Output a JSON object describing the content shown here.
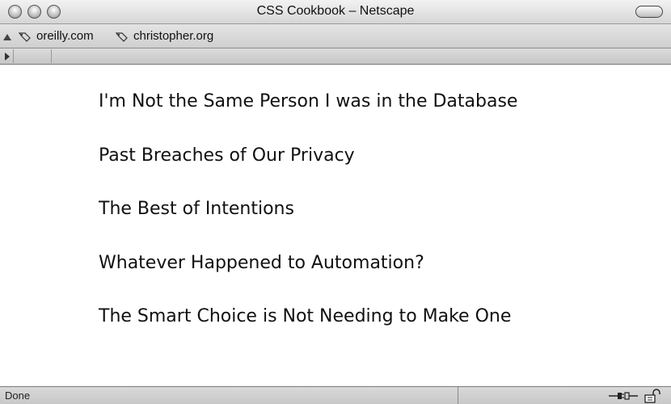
{
  "window": {
    "title": "CSS Cookbook – Netscape"
  },
  "bookmarks": {
    "items": [
      {
        "label": "oreilly.com",
        "icon": "bookmark-icon"
      },
      {
        "label": "christopher.org",
        "icon": "bookmark-icon"
      }
    ]
  },
  "content": {
    "headings": [
      "I'm Not the Same Person I was in the Database",
      "Past Breaches of Our Privacy",
      "The Best of Intentions",
      "Whatever Happened to Automation?",
      "The Smart Choice is Not Needing to Make One"
    ]
  },
  "status": {
    "text": "Done",
    "icons": [
      "connection-icon",
      "security-lock-icon"
    ]
  }
}
